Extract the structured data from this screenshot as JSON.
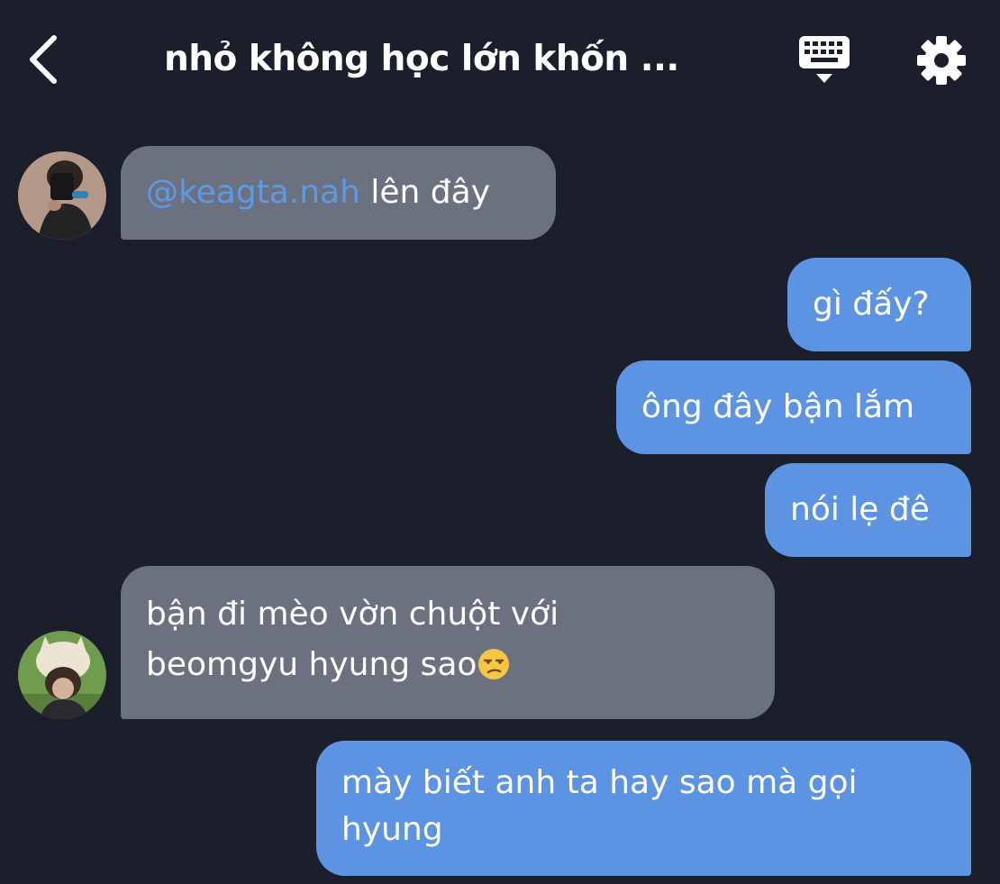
{
  "header": {
    "title": "nhỏ không học lớn khốn ...",
    "back_icon": "chevron-left-icon",
    "keyboard_icon": "keyboard-icon",
    "settings_icon": "gear-icon"
  },
  "messages": [
    {
      "direction": "incoming",
      "mention": "@keagta.nah",
      "text": " lên đây"
    },
    {
      "direction": "outgoing",
      "text": "gì đấy?"
    },
    {
      "direction": "outgoing",
      "text": "ông đây bận lắm"
    },
    {
      "direction": "outgoing",
      "text": "nói lẹ đê"
    },
    {
      "direction": "incoming",
      "line1": "bận đi mèo vờn chuột với",
      "line2": "beomgyu hyung sao",
      "emoji": "unamused-face-icon"
    },
    {
      "direction": "outgoing",
      "line1": "mày biết anh ta hay sao mà gọi",
      "line2": "hyung"
    }
  ],
  "colors": {
    "background": "#1b1e2b",
    "incoming_bubble": "#6b717f",
    "outgoing_bubble": "#5c93e2",
    "mention": "#5c9ae6",
    "text": "#ffffff"
  }
}
